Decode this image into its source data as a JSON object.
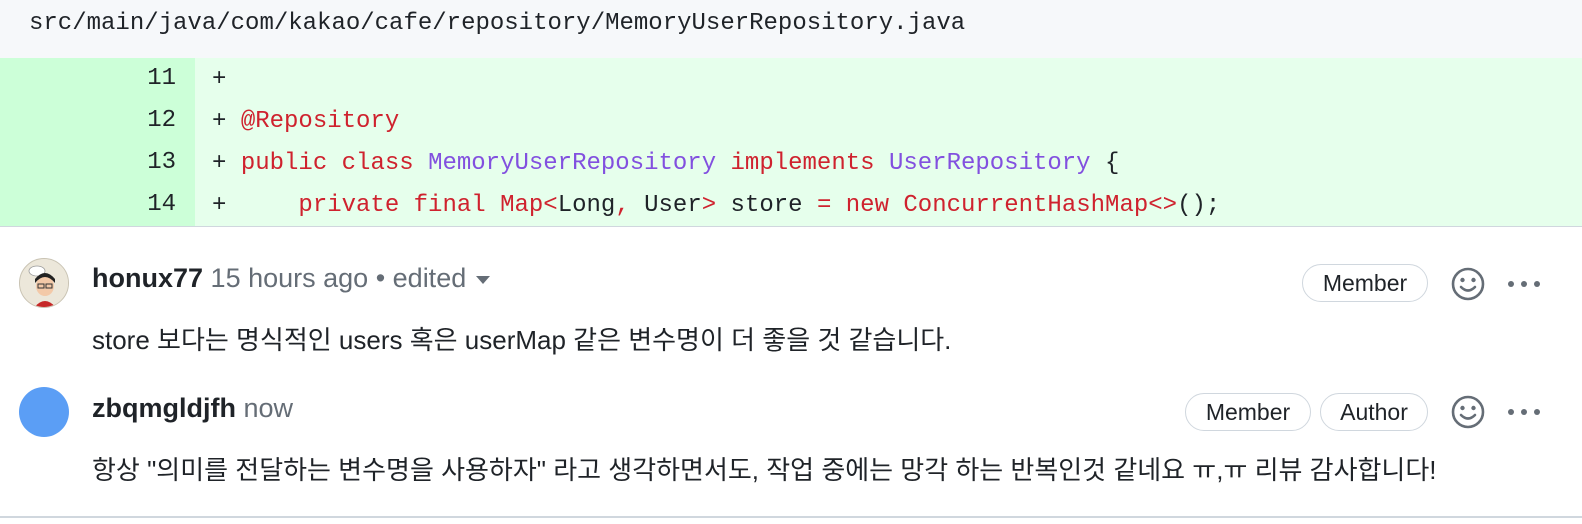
{
  "file": {
    "path": "src/main/java/com/kakao/cafe/repository/MemoryUserRepository.java"
  },
  "diff": {
    "lines": [
      {
        "number": "11",
        "marker": "+"
      },
      {
        "number": "12",
        "marker": "+",
        "annotation": "@Repository"
      },
      {
        "number": "13",
        "marker": "+",
        "kw1": "public",
        "kw2": "class",
        "type1": "MemoryUserRepository",
        "kw3": "implements",
        "type2": "UserRepository",
        "brace": "{"
      },
      {
        "number": "14",
        "marker": "+",
        "indent": "    ",
        "kw1": "private",
        "kw2": "final",
        "t1": "Map",
        "lt": "<",
        "t2": "Long",
        "comma": ",",
        "t3": " User",
        "gt": ">",
        "name": " store ",
        "eq": "=",
        "sp": " ",
        "kw3": "new",
        "t4": " ConcurrentHashMap",
        "diamond": "<>",
        "tail": "();"
      }
    ]
  },
  "comments": [
    {
      "author": "honux77",
      "time": "15 hours ago",
      "separator": "•",
      "edited": "edited",
      "badges": [
        "Member"
      ],
      "body": "store 보다는 명식적인 users 혹은 userMap 같은 변수명이 더 좋을 것 같습니다."
    },
    {
      "author": "zbqmgldjfh",
      "time": "now",
      "badges": [
        "Member",
        "Author"
      ],
      "body": "항상 \"의미를 전달하는 변수명을 사용하자\" 라고 생각하면서도, 작업 중에는 망각 하는 반복인것 같네요 ㅠ,ㅠ 리뷰 감사합니다!"
    }
  ],
  "icons": {
    "reaction": "smiley-icon",
    "more": "kebab-horizontal-icon"
  },
  "colors": {
    "added_bg": "#e6ffec",
    "added_gutter": "#ccffd8",
    "keyword": "#cf222e",
    "type": "#8250df",
    "avatar_blue": "#5b9ef5"
  }
}
